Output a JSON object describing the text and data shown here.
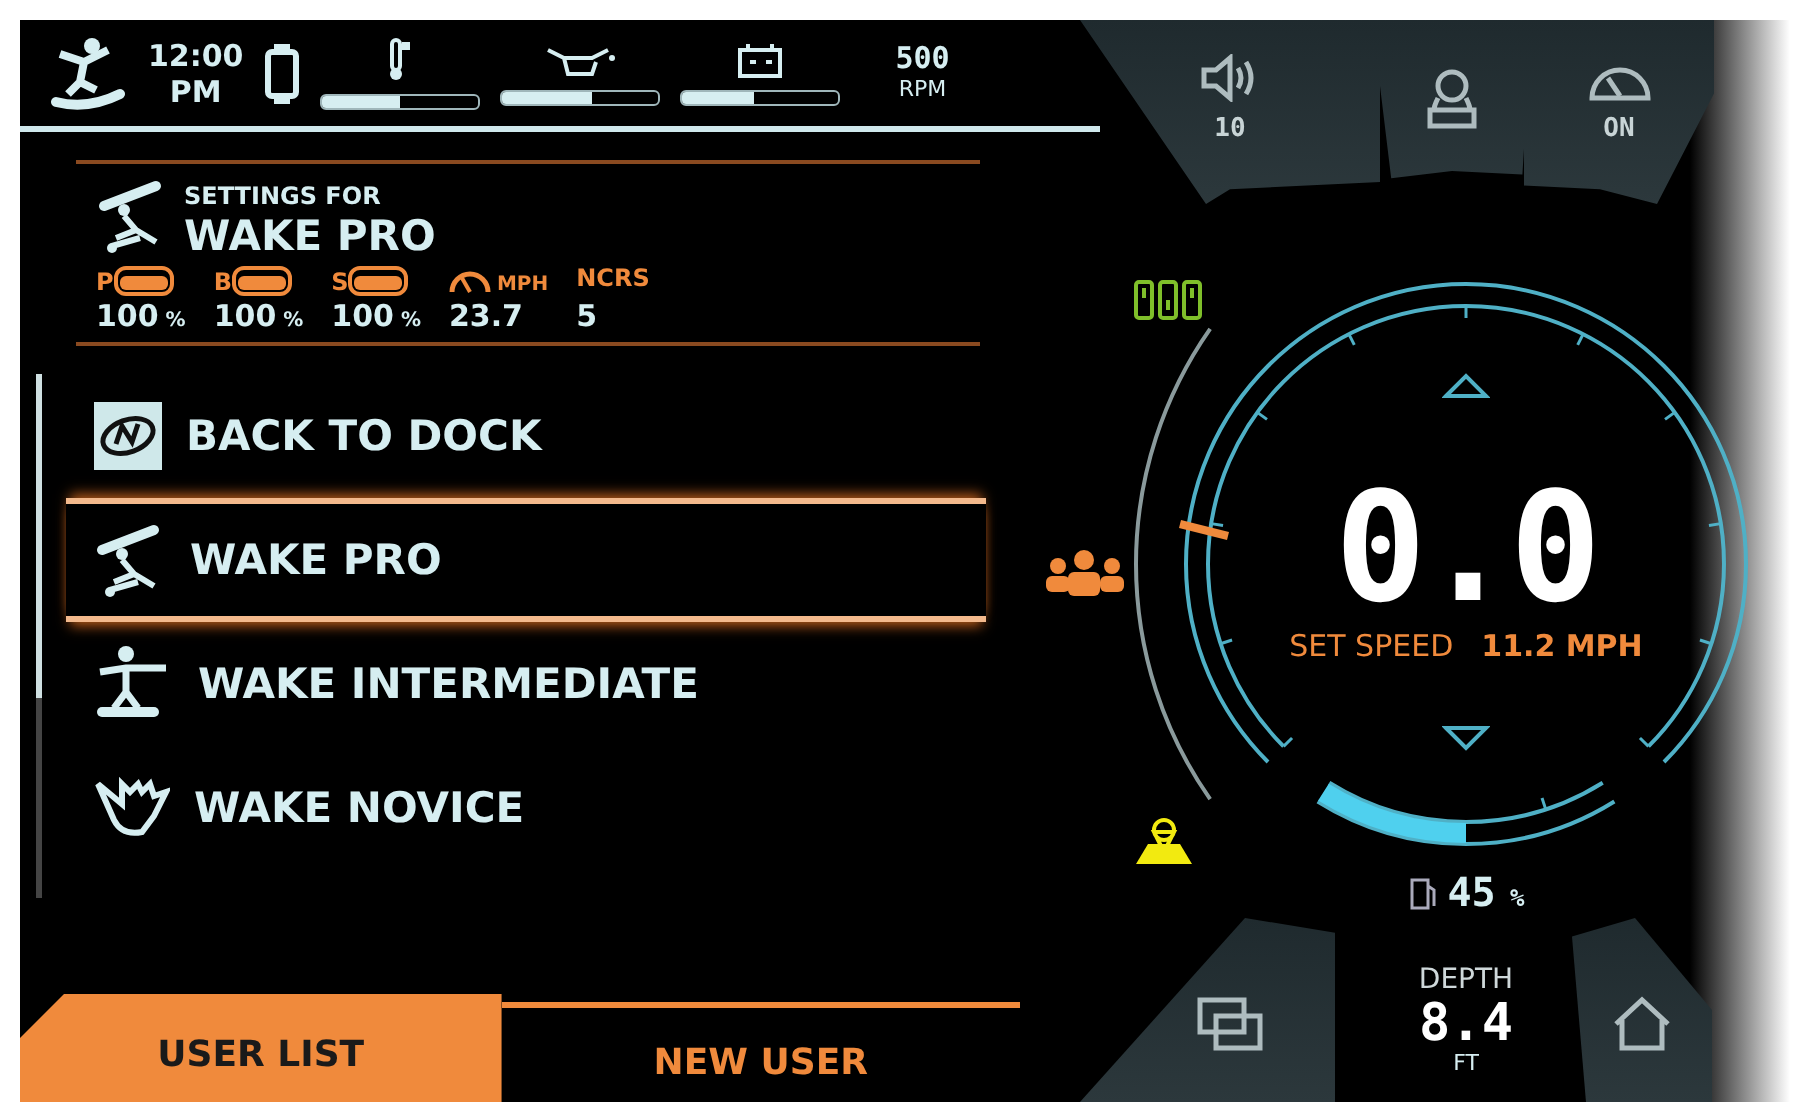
{
  "status_bar": {
    "time": "12:00",
    "period": "PM",
    "gauges": [
      {
        "kind": "temperature",
        "level": 0.5
      },
      {
        "kind": "oil",
        "level": 0.58
      },
      {
        "kind": "battery",
        "level": 0.47
      }
    ],
    "rpm_value": "500",
    "rpm_unit": "RPM"
  },
  "settings": {
    "caption": "SETTINGS FOR",
    "profile": "WAKE PRO",
    "stats": [
      {
        "kind": "ballast",
        "letter": "P",
        "value": "100",
        "unit": "%"
      },
      {
        "kind": "ballast",
        "letter": "B",
        "value": "100",
        "unit": "%"
      },
      {
        "kind": "ballast",
        "letter": "S",
        "value": "100",
        "unit": "%"
      },
      {
        "kind": "speed",
        "label": "MPH",
        "value": "23.7"
      },
      {
        "kind": "text",
        "label": "NCRS",
        "value": "5"
      }
    ]
  },
  "user_list": [
    {
      "kind": "dock",
      "label": "BACK TO DOCK",
      "selected": false
    },
    {
      "kind": "pro",
      "label": "WAKE PRO",
      "selected": true
    },
    {
      "kind": "intermediate",
      "label": "WAKE INTERMEDIATE",
      "selected": false
    },
    {
      "kind": "novice",
      "label": "WAKE NOVICE",
      "selected": false
    }
  ],
  "tabs": [
    {
      "label": "USER LIST",
      "selected": true
    },
    {
      "label": "NEW USER",
      "selected": false
    }
  ],
  "top_buttons": [
    {
      "kind": "volume",
      "label": "10"
    },
    {
      "kind": "profile"
    },
    {
      "kind": "cruise",
      "label": "ON"
    }
  ],
  "speed": {
    "value": "0.0",
    "set_label": "SET SPEED",
    "set_value": "11.2 MPH",
    "level": 0.5
  },
  "fuel": {
    "value": "45",
    "unit": "%"
  },
  "depth": {
    "label": "DEPTH",
    "value": "8.4",
    "unit": "FT"
  },
  "bottom_buttons": [
    {
      "kind": "screens"
    },
    {
      "kind": "home"
    }
  ]
}
